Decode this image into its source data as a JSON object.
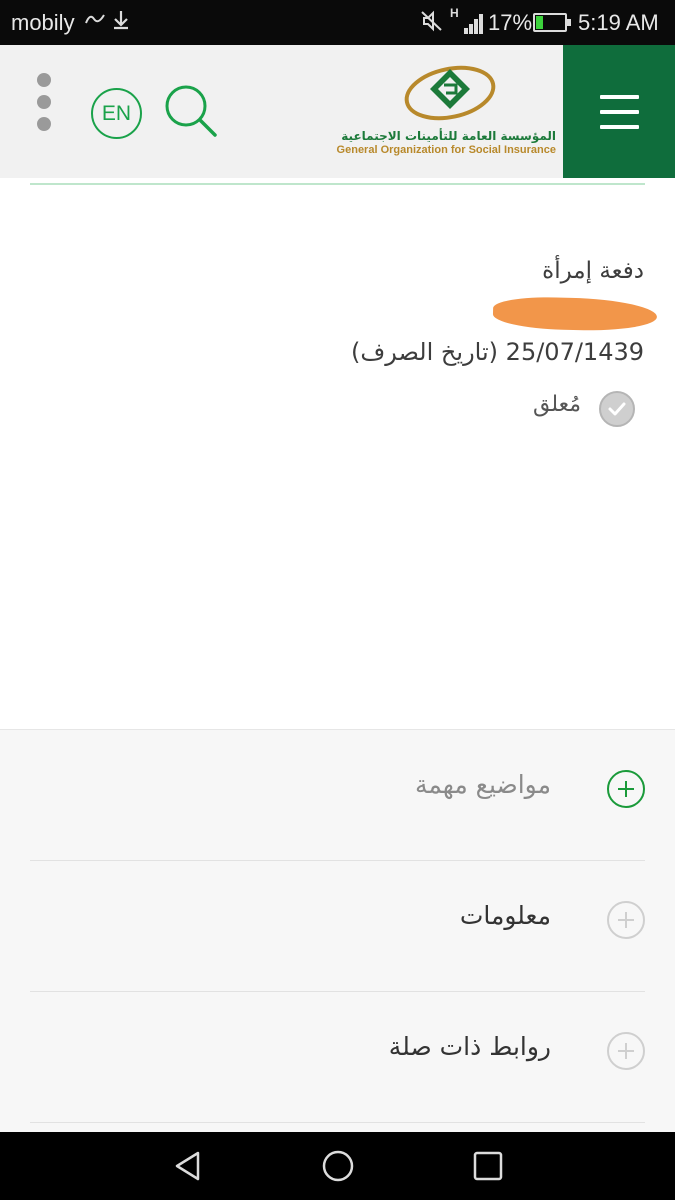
{
  "status_bar": {
    "carrier": "mobily",
    "network_type": "H",
    "battery": "17%",
    "battery_level": 0.17,
    "time": "5:19 AM"
  },
  "header": {
    "language_button": "EN",
    "logo": {
      "arabic_name": "المؤسسة العامة للتأمينات الاجتماعية",
      "english_name": "General Organization for Social Insurance"
    },
    "icons": [
      "more-vert-icon",
      "search-icon",
      "hamburger-menu-icon"
    ]
  },
  "colors": {
    "brand_green": "#0f6d3c",
    "accent_green": "#1aa24a",
    "logo_gold": "#b8892b",
    "redaction": "#f2964a"
  },
  "payment": {
    "type": "دفعة إمرأة",
    "date": "25/07/1439",
    "date_label": "(تاريخ الصرف)",
    "status": "مُعلق"
  },
  "accordion": [
    {
      "label": "مواضيع مهمة",
      "expanded": true
    },
    {
      "label": "معلومات",
      "expanded": false
    },
    {
      "label": "روابط ذات صلة",
      "expanded": false
    }
  ]
}
